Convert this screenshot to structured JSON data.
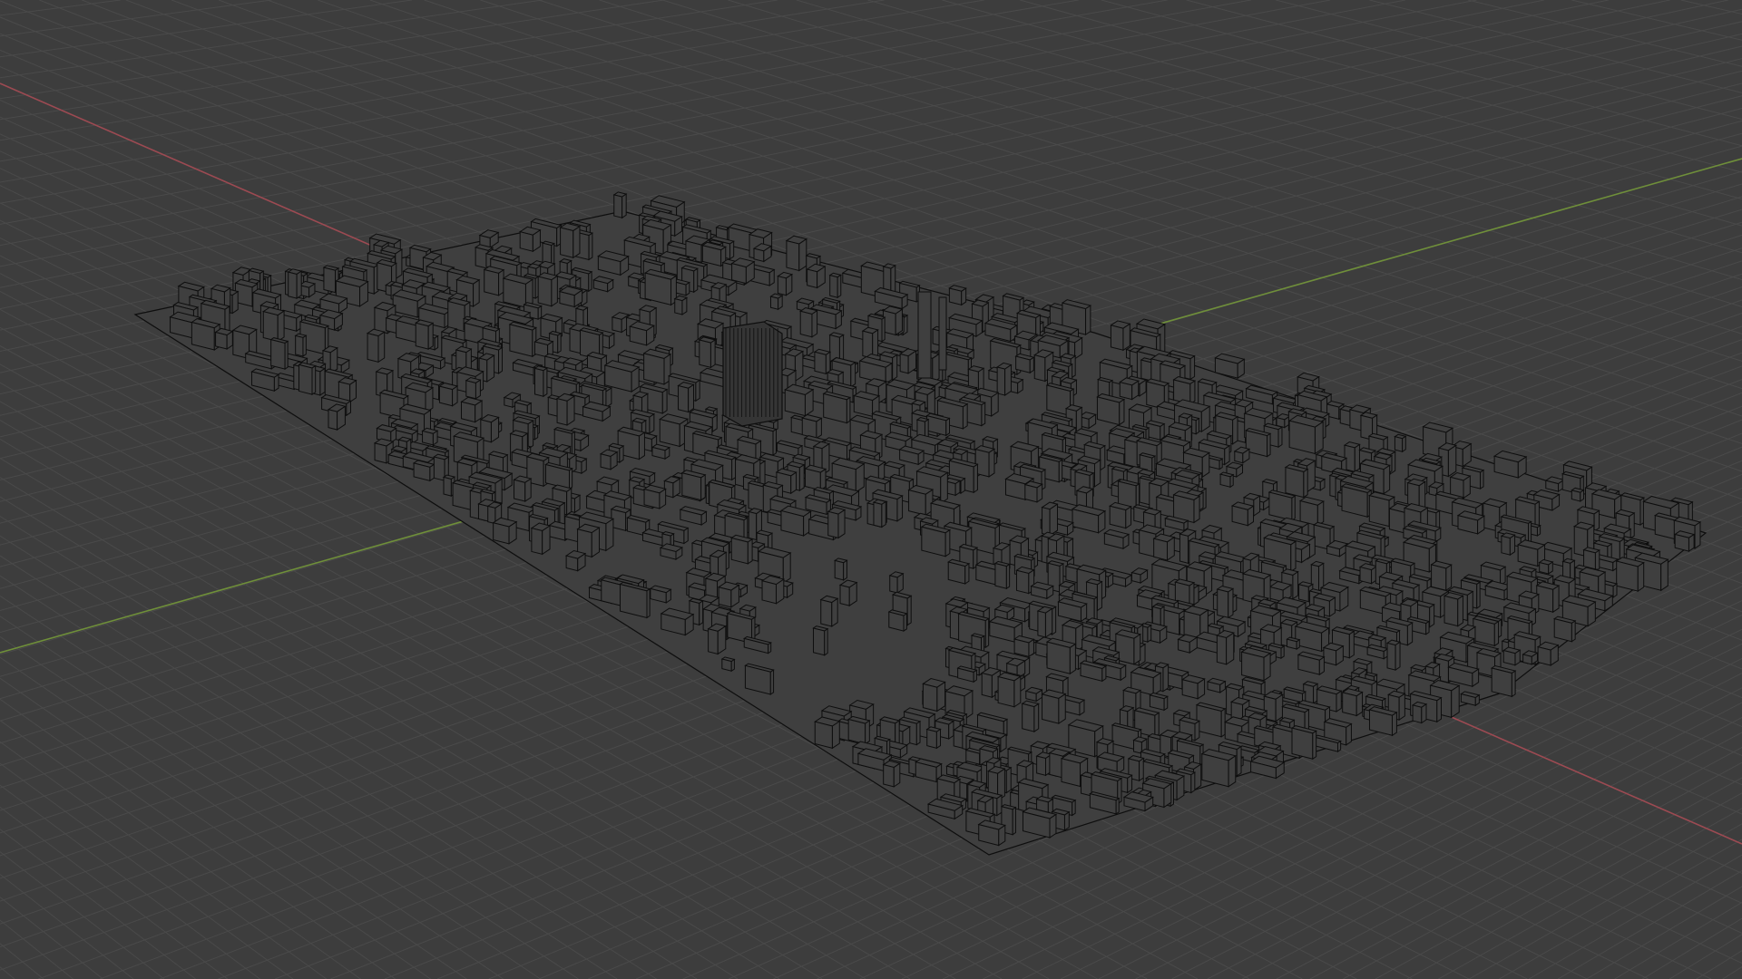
{
  "viewport": {
    "background_color": "#3d3d3d",
    "grid_color": "#4a4a4a",
    "x_axis_color": "#9c4a52",
    "y_axis_color": "#6f8f3a",
    "model_face_color": "#3f3f3f",
    "model_edge_color": "#0e0e0e"
  }
}
